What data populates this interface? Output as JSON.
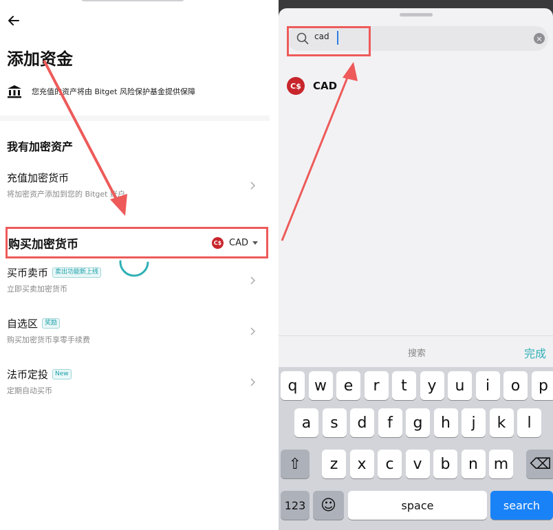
{
  "left": {
    "title": "添加资金",
    "protect_text": "您充值的资产将由 Bitget 风险保护基金提供保障",
    "section_title": "我有加密资产",
    "items": [
      {
        "title": "充值加密货币",
        "sub": "将加密资产添加到您的 Bitget 账户",
        "badge": ""
      },
      {
        "title": "买币卖币",
        "sub": "立即买卖加密货币",
        "badge": "卖出功能新上线"
      },
      {
        "title": "自选区",
        "sub": "购买加密货币享零手续费",
        "badge": "奖励"
      },
      {
        "title": "法币定投",
        "sub": "定期自动买币",
        "badge": "New"
      }
    ],
    "buy_row": {
      "label": "购买加密货币",
      "currency": "CAD",
      "currency_icon": "C$"
    }
  },
  "right": {
    "search": {
      "value": "cad",
      "placeholder": ""
    },
    "result": {
      "icon": "C$",
      "code": "CAD"
    },
    "toolbar": {
      "hint": "搜索",
      "done": "完成"
    },
    "keyboard": {
      "row1": [
        "q",
        "w",
        "e",
        "r",
        "t",
        "y",
        "u",
        "i",
        "o",
        "p"
      ],
      "row2": [
        "a",
        "s",
        "d",
        "f",
        "g",
        "h",
        "j",
        "k",
        "l"
      ],
      "row3": [
        "z",
        "x",
        "c",
        "v",
        "b",
        "n",
        "m"
      ],
      "shift": "⇧",
      "backspace": "⌫",
      "numbers": "123",
      "emoji": "☺",
      "space": "space",
      "search": "search"
    }
  },
  "colors": {
    "highlight": "#ee5a5a",
    "accent": "#2fb0b5",
    "cad_red": "#c8252c",
    "key_blue": "#1a82f7"
  }
}
